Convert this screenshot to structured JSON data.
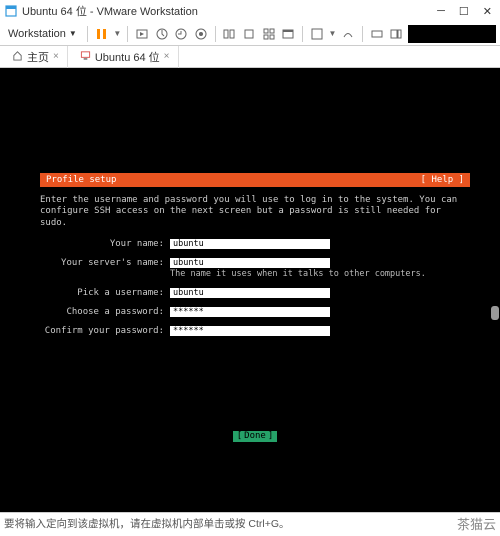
{
  "window": {
    "title": "Ubuntu 64 位 - VMware Workstation"
  },
  "toolbar": {
    "workstation": "Workstation"
  },
  "tabs": {
    "home": "主页",
    "vm": "Ubuntu 64 位"
  },
  "installer": {
    "header_title": "Profile setup",
    "header_help": "[ Help ]",
    "description": "Enter the username and password you will use to log in to the system. You can configure SSH access on the next screen but a password is still needed for sudo.",
    "fields": {
      "your_name": {
        "label": "Your name:",
        "value": "ubuntu"
      },
      "server_name": {
        "label": "Your server's name:",
        "value": "ubuntu",
        "hint": "The name it uses when it talks to other computers."
      },
      "username": {
        "label": "Pick a username:",
        "value": "ubuntu"
      },
      "password": {
        "label": "Choose a password:",
        "value": "******"
      },
      "confirm": {
        "label": "Confirm your password:",
        "value": "******"
      }
    },
    "done": "Done"
  },
  "statusbar": {
    "message": "要将输入定向到该虚拟机，请在虚拟机内部单击或按 Ctrl+G。"
  },
  "watermark": "茶猫云"
}
